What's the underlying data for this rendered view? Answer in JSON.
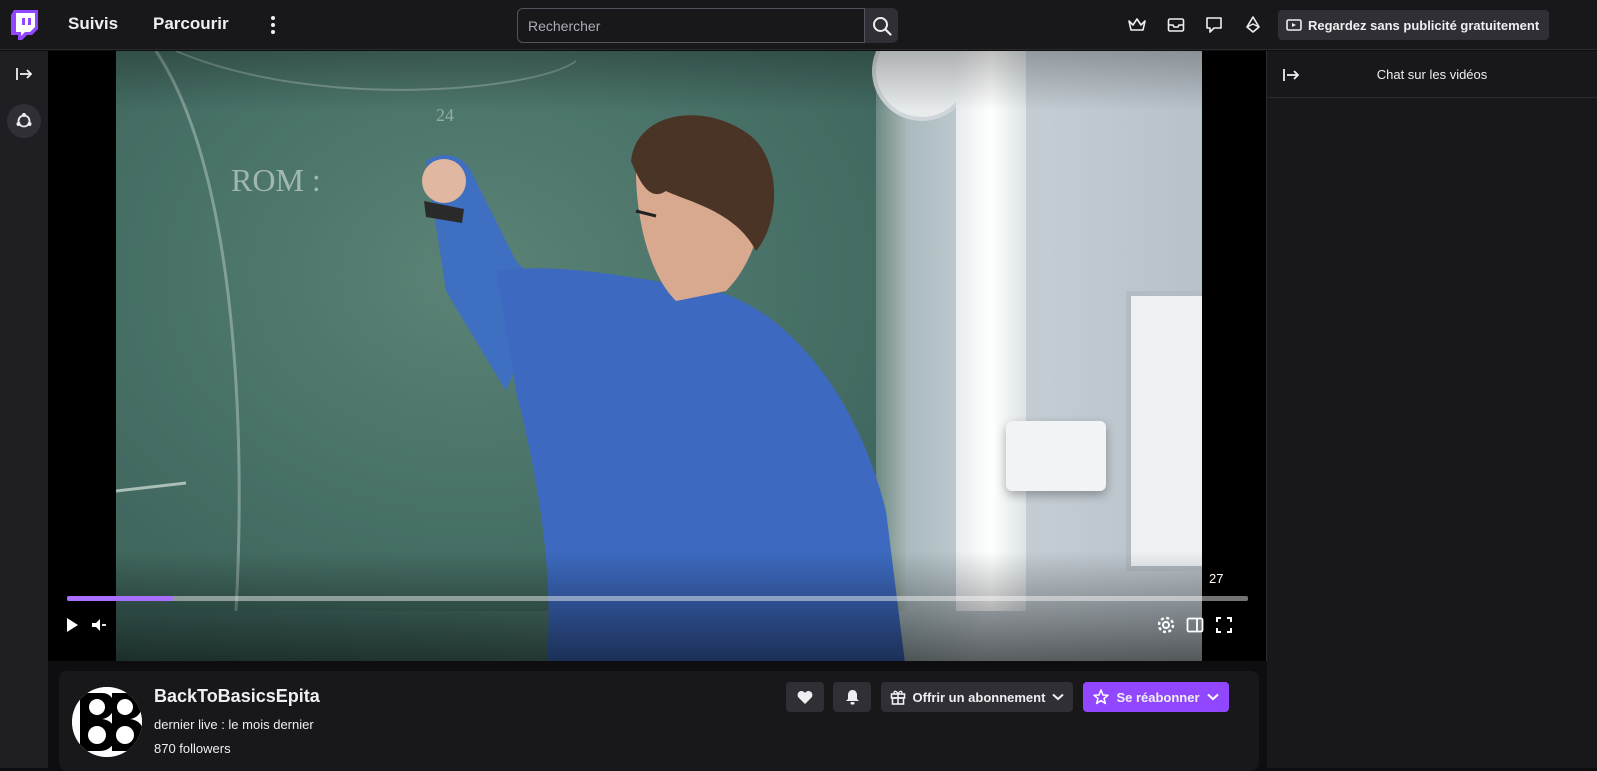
{
  "topbar": {
    "nav": {
      "following": "Suivis",
      "browse": "Parcourir"
    },
    "search": {
      "placeholder": "Rechercher"
    },
    "adfree_label": "Regardez sans publicité gratuitement"
  },
  "player": {
    "time": "27",
    "progress": 0.09
  },
  "chat": {
    "title": "Chat sur les vidéos"
  },
  "channel": {
    "name": "BackToBasicsEpita",
    "last_live": "dernier live : le mois dernier",
    "followers": "870 followers",
    "gift_label": "Offrir un abonnement",
    "resub_label": "Se réabonner"
  },
  "colors": {
    "accent": "#9147ff",
    "progress": "#a970ff",
    "topbar": "#18181b"
  }
}
